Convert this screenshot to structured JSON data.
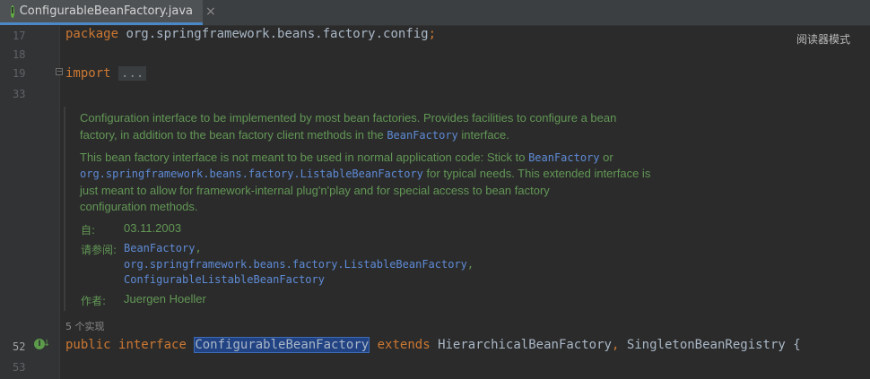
{
  "tab": {
    "icon": "interface-icon",
    "icon_letter": "I",
    "title": "ConfigurableBeanFactory.java",
    "close": "×"
  },
  "reader_mode": "阅读器模式",
  "gutter": {
    "lines": [
      "17",
      "18",
      "19",
      "33",
      "52",
      "53"
    ]
  },
  "code": {
    "line17": {
      "kw": "package",
      "rest": " org.springframework.beans.factory.config",
      "semi": ";"
    },
    "line19": {
      "kw": "import",
      "fold": "..."
    },
    "line52": {
      "kw1": "public",
      "kw2": "interface",
      "name": "ConfigurableBeanFactory",
      "kw3": "extends",
      "parent1": "HierarchicalBeanFactory",
      "comma": ",",
      "parent2": "SingletonBeanRegistry",
      "brace": "{"
    }
  },
  "javadoc": {
    "p1_line1": "Configuration interface to be implemented by most bean factories. Provides facilities to configure a bean",
    "p1_line2_a": "factory, in addition to the bean factory client methods in the",
    "p1_line2_code": "BeanFactory",
    "p1_line2_b": "interface.",
    "p2_line1_a": "This bean factory interface is not meant to be used in normal application code: Stick to",
    "p2_line1_code": "BeanFactory",
    "p2_line1_b": "or",
    "p2_line2_code": "org.springframework.beans.factory.ListableBeanFactory",
    "p2_line2_b": "for typical needs. This extended interface is",
    "p2_line3": "just meant to allow for framework-internal plug'n'play and for special access to bean factory",
    "p2_line4": "configuration methods.",
    "since_label": "自:",
    "since_value": "03.11.2003",
    "see_label": "请参阅:",
    "see_1": "BeanFactory",
    "see_2": "org.springframework.beans.factory.ListableBeanFactory",
    "see_3": "ConfigurableListableBeanFactory",
    "see_comma": ",",
    "author_label": "作者:",
    "author_value": "Juergen Hoeller"
  },
  "implementations": "5 个实现",
  "colors": {
    "keyword": "#cc7832",
    "doc_text": "#629755",
    "doc_link": "#5e8bd6",
    "background": "#2b2b2b"
  }
}
